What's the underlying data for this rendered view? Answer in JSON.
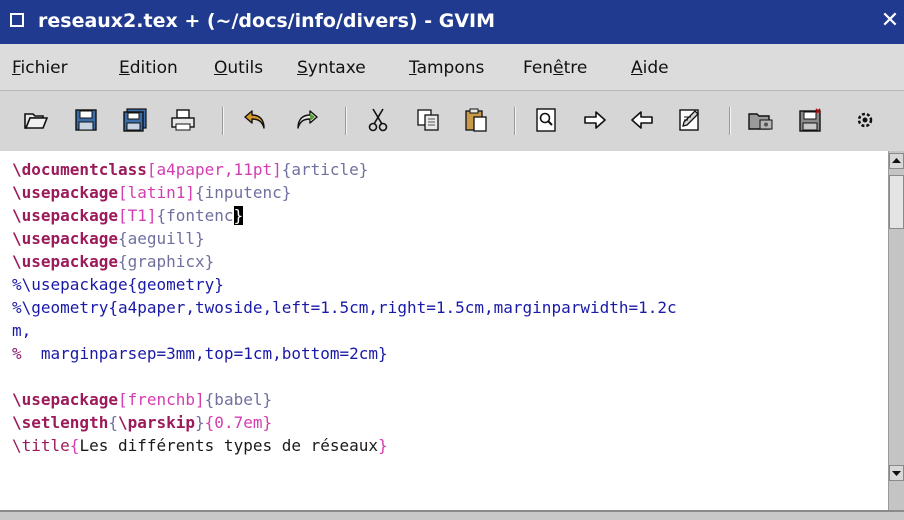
{
  "window": {
    "title": "reseaux2.tex + (~/docs/info/divers) - GVIM",
    "close_glyph": "✕"
  },
  "menu": {
    "items": [
      {
        "first": "F",
        "rest": "ichier"
      },
      {
        "first": "E",
        "rest": "dition"
      },
      {
        "first": "O",
        "rest": "utils"
      },
      {
        "first": "S",
        "rest": "yntaxe"
      },
      {
        "first": "T",
        "rest": "ampons"
      },
      {
        "pre": "Fen",
        "first": "ê",
        "rest": "tre"
      },
      {
        "first": "A",
        "rest": "ide"
      }
    ]
  },
  "toolbar": {
    "icons": [
      "open-folder-icon",
      "save-icon",
      "save-all-icon",
      "print-icon",
      "undo-icon",
      "redo-icon",
      "cut-icon",
      "copy-icon",
      "paste-icon",
      "find-icon",
      "find-next-icon",
      "find-prev-icon",
      "replace-icon",
      "load-session-icon",
      "save-session-icon",
      "settings-icon"
    ]
  },
  "editor": {
    "lines": [
      [
        {
          "t": "\\documentclass",
          "c": "cmd"
        },
        {
          "t": "[a4paper,11pt]",
          "c": "opt"
        },
        {
          "t": "{article}",
          "c": "arg"
        }
      ],
      [
        {
          "t": "\\usepackage",
          "c": "cmd"
        },
        {
          "t": "[latin1]",
          "c": "opt"
        },
        {
          "t": "{inputenc}",
          "c": "arg"
        }
      ],
      [
        {
          "t": "\\usepackage",
          "c": "cmd"
        },
        {
          "t": "[T1]",
          "c": "opt"
        },
        {
          "t": "{fontenc",
          "c": "arg"
        },
        {
          "t": "}",
          "c": "cursor"
        }
      ],
      [
        {
          "t": "\\usepackage",
          "c": "cmd"
        },
        {
          "t": "{aeguill}",
          "c": "arg"
        }
      ],
      [
        {
          "t": "\\usepackage",
          "c": "cmd"
        },
        {
          "t": "{graphicx}",
          "c": "arg"
        }
      ],
      [
        {
          "t": "%\\usepackage{geometry}",
          "c": "cmt"
        }
      ],
      [
        {
          "t": "%\\geometry{a4paper,twoside,left=1.5cm,right=1.5cm,marginparwidth=1.2c",
          "c": "cmt"
        }
      ],
      [
        {
          "t": "m,",
          "c": "cmt"
        }
      ],
      [
        {
          "t": "%",
          "c": "pct"
        },
        {
          "t": "  marginparsep=3mm,top=1cm,bottom=2cm}",
          "c": "cmt"
        }
      ],
      [
        {
          "t": "",
          "c": ""
        }
      ],
      [
        {
          "t": "\\usepackage",
          "c": "cmd"
        },
        {
          "t": "[frenchb]",
          "c": "opt"
        },
        {
          "t": "{babel}",
          "c": "arg"
        }
      ],
      [
        {
          "t": "\\setlength",
          "c": "cmd"
        },
        {
          "t": "{",
          "c": "arg"
        },
        {
          "t": "\\parskip",
          "c": "cmd"
        },
        {
          "t": "}",
          "c": "arg"
        },
        {
          "t": "{0.7em}",
          "c": "opt"
        }
      ],
      [
        {
          "t": "\\title",
          "c": "cmd2"
        },
        {
          "t": "{",
          "c": "opt"
        },
        {
          "t": "Les différents types de réseaux",
          "c": ""
        },
        {
          "t": "}",
          "c": "opt"
        }
      ]
    ]
  }
}
